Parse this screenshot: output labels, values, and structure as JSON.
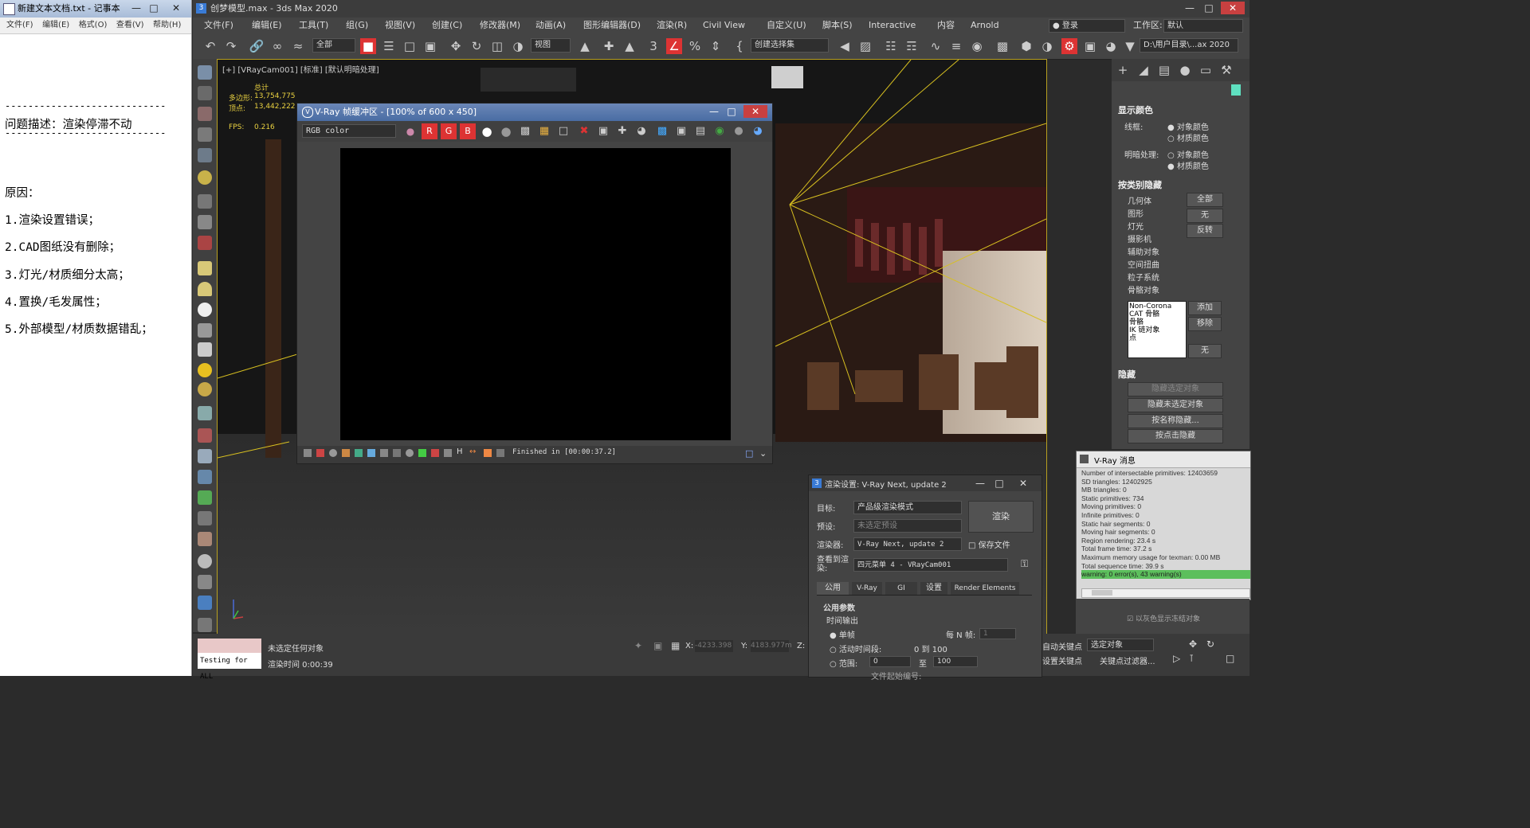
{
  "notepad": {
    "title": "新建文本文档.txt - 记事本",
    "menu": [
      "文件(F)",
      "编辑(E)",
      "格式(O)",
      "查看(V)",
      "帮助(H)"
    ],
    "lines": {
      "sep1": "----------------------------",
      "desc": "问题描述：渲染停滞不动",
      "sep2": "----------------------------",
      "reason": "原因：",
      "r1": "1.渲染设置错误；",
      "r2": "2.CAD图纸没有删除；",
      "r3": "3.灯光/材质细分太高；",
      "r4": "4.置换/毛发属性；",
      "r5": "5.外部模型/材质数据错乱；"
    }
  },
  "max": {
    "title": "创梦模型.max - 3ds Max 2020",
    "menu": [
      "文件(F)",
      "编辑(E)",
      "工具(T)",
      "组(G)",
      "视图(V)",
      "创建(C)",
      "修改器(M)",
      "动画(A)",
      "图形编辑器(D)",
      "渲染(R)",
      "Civil View",
      "自定义(U)",
      "脚本(S)",
      "Interactive",
      "内容",
      "Arnold"
    ],
    "login": "登录",
    "workspace_label": "工作区:",
    "workspace_value": "默认",
    "toolbar": {
      "filter": "全部",
      "view": "视图",
      "selection_set": "创建选择集",
      "path": "D:\\用户目录\\...ax 2020"
    },
    "viewport": {
      "label": "[+] [VRayCam001] [标准] [默认明暗处理]",
      "stats_total": "总计",
      "polys_label": "多边形:",
      "polys": "13,754,775",
      "verts_label": "顶点:",
      "verts": "13,442,222",
      "fps_label": "FPS:",
      "fps": "0.216"
    },
    "panel": {
      "display_color": "显示颜色",
      "wireframe": "线框:",
      "shaded": "明暗处理:",
      "obj_color": "对象颜色",
      "mat_color": "材质颜色",
      "hide_by_cat": "按类别隐藏",
      "cats": [
        "几何体",
        "图形",
        "灯光",
        "摄影机",
        "辅助对象",
        "空间扭曲",
        "粒子系统",
        "骨骼对象"
      ],
      "btn_all": "全部",
      "btn_none": "无",
      "btn_invert": "反转",
      "list": [
        "Non-Corona",
        "CAT 骨骼",
        "骨骼",
        "IK 链对象",
        "点"
      ],
      "btn_add": "添加",
      "btn_remove": "移除",
      "btn_none2": "无",
      "hide": "隐藏",
      "hide_sel": "隐藏选定对象",
      "hide_unsel": "隐藏未选定对象",
      "hide_by_name": "按名称隐藏...",
      "hide_by_click": "按点击隐藏"
    },
    "status": {
      "script": "Testing for ALL",
      "none_sel": "未选定任何对象",
      "render_time": "渲染时间  0:00:39",
      "x_label": "X:",
      "x_val": "-4233.398",
      "y_label": "Y:",
      "y_val": "4183.977m",
      "z_label": "Z:",
      "auto_key": "自动关键点",
      "set_key": "设置关键点",
      "sel_obj": "选定对象",
      "key_filter": "关键点过滤器..."
    }
  },
  "vfb": {
    "title": "V-Ray 帧缓冲区 - [100% of 600 x 450]",
    "channel": "RGB color",
    "r": "R",
    "g": "G",
    "b": "B",
    "finished": "Finished in [00:00:37.2]"
  },
  "render_setup": {
    "title": "渲染设置: V-Ray Next, update 2",
    "target_label": "目标:",
    "target": "产品级渲染模式",
    "preset_label": "预设:",
    "preset": "未选定预设",
    "renderer_label": "渲染器:",
    "renderer": "V-Ray Next, update 2",
    "save_file": "保存文件",
    "view_label": "查看到渲染:",
    "view": "四元菜单 4 - VRayCam001",
    "render_btn": "渲染",
    "tabs": [
      "公用",
      "V-Ray",
      "GI",
      "设置",
      "Render Elements"
    ],
    "common_params": "公用参数",
    "time_output": "时间输出",
    "single": "单帧",
    "every_n": "每 N 帧:",
    "every_n_val": "1",
    "active_seg": "活动时间段:",
    "active_range": "0 到 100",
    "range": "范围:",
    "range_from": "0",
    "range_to_label": "至",
    "range_to": "100",
    "file_start": "文件起始编号:"
  },
  "vray_msg": {
    "title": "V-Ray 消息",
    "lines": [
      "Number of intersectable primitives: 12403659",
      "SD triangles: 12402925",
      "MB triangles: 0",
      "Static primitives: 734",
      "Moving primitives: 0",
      "Infinite primitives: 0",
      "Static hair segments: 0",
      "Moving hair segments: 0",
      "Region rendering: 23.4 s",
      "Total frame time: 37.2 s",
      "Maximum memory usage for texman: 0.00 MB",
      "Total sequence time: 39.9 s"
    ],
    "warning": "warning: 0 error(s), 43 warning(s)",
    "behind1": "以灰色显示冻结对象"
  }
}
